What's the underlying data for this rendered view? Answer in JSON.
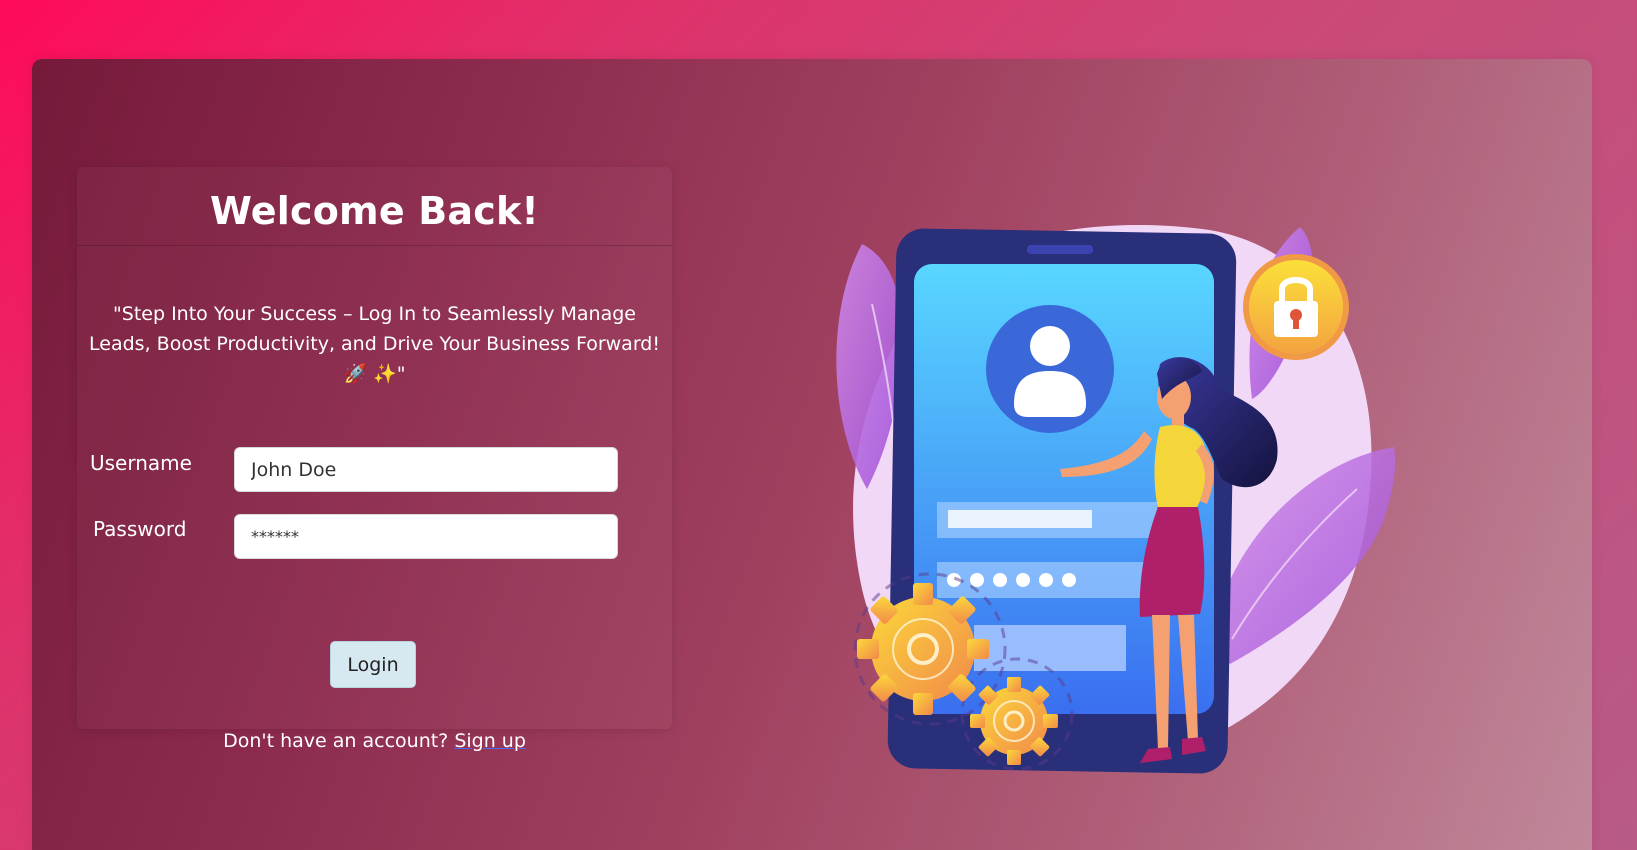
{
  "login": {
    "title": "Welcome Back!",
    "tagline": "\"Step Into Your Success – Log In to Seamlessly Manage Leads, Boost Productivity, and Drive Your Business Forward! 🚀 ✨\"",
    "username_label": "Username",
    "username_value": "John Doe",
    "password_label": "Password",
    "password_value": "******",
    "login_button": "Login",
    "signup_prompt": "Don't have an account?",
    "signup_link": "Sign up"
  },
  "illustration": {
    "icons": [
      "user-avatar-icon",
      "padlock-icon",
      "gear-icon",
      "password-dots-icon"
    ],
    "colors": {
      "blob": "#f0d6f6",
      "phone_body": "#2a2f7a",
      "phone_screen": "#4aa8f7",
      "lock_circle": "#f5c23a",
      "gear": "#f5b544",
      "skirt": "#b0206a",
      "hair": "#1b1a4e"
    }
  },
  "colors": {
    "page_bg_start": "#ff0a5a",
    "frame_bg_start": "#751a3a",
    "button_bg": "#d6e9f1",
    "link_underline": "#4c6cff"
  }
}
